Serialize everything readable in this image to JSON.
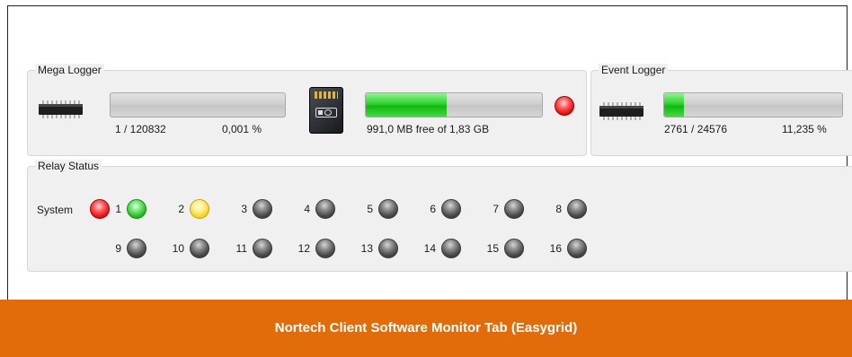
{
  "mega_logger": {
    "title": "Mega Logger",
    "progress": 1e-05,
    "count_text": "1 / 120832",
    "percent_text": "0,001 %",
    "storage_progress": 0.46,
    "storage_text": "991,0 MB free of 1,83 GB",
    "status_led": "red"
  },
  "event_logger": {
    "title": "Event Logger",
    "progress": 0.11235,
    "count_text": "2761 / 24576",
    "percent_text": "11,235 %"
  },
  "relay_status": {
    "title": "Relay Status",
    "system_label": "System",
    "system_state": "red",
    "relays": [
      {
        "label": "1",
        "state": "green"
      },
      {
        "label": "2",
        "state": "yellow"
      },
      {
        "label": "3",
        "state": "off"
      },
      {
        "label": "4",
        "state": "off"
      },
      {
        "label": "5",
        "state": "off"
      },
      {
        "label": "6",
        "state": "off"
      },
      {
        "label": "7",
        "state": "off"
      },
      {
        "label": "8",
        "state": "off"
      },
      {
        "label": "9",
        "state": "off"
      },
      {
        "label": "10",
        "state": "off"
      },
      {
        "label": "11",
        "state": "off"
      },
      {
        "label": "12",
        "state": "off"
      },
      {
        "label": "13",
        "state": "off"
      },
      {
        "label": "14",
        "state": "off"
      },
      {
        "label": "15",
        "state": "off"
      },
      {
        "label": "16",
        "state": "off"
      }
    ]
  },
  "icons": {
    "memory_chip": "chip-icon",
    "sd_card": "sd-card-icon"
  },
  "colors": {
    "banner": "#e36c0a",
    "progress_fill": "#22c322"
  },
  "caption": "Nortech Client Software Monitor Tab (Easygrid)"
}
